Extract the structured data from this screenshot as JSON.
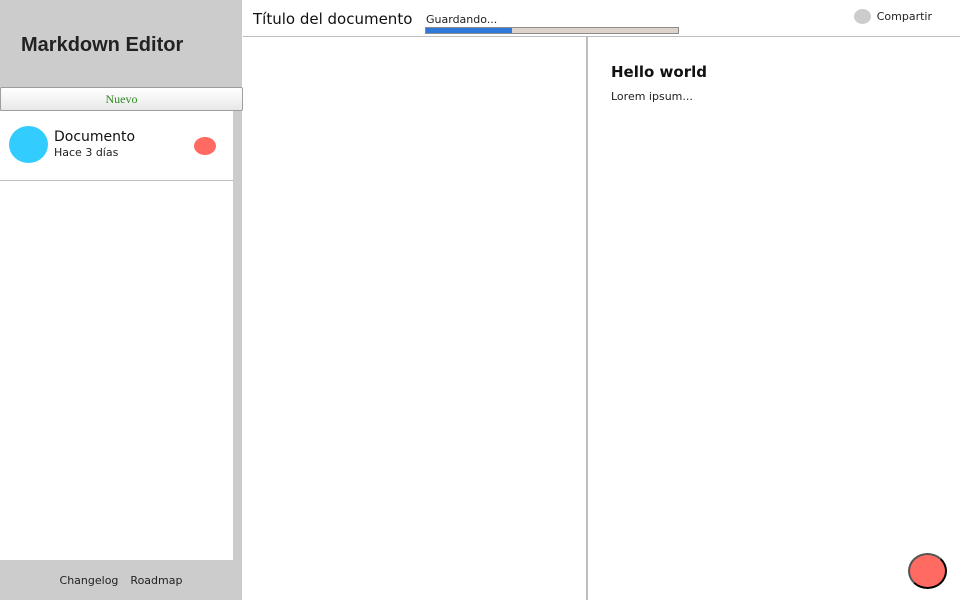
{
  "sidebar": {
    "app_title": "Markdown Editor",
    "new_button_label": "Nuevo",
    "documents": [
      {
        "name": "Documento",
        "date": "Hace 3 días"
      }
    ],
    "footer_links": [
      "Changelog",
      "Roadmap"
    ]
  },
  "topbar": {
    "document_title": "Título del documento",
    "saving_status": "Guardando...",
    "saving_progress": 0.34,
    "share_label": "Compartir"
  },
  "preview": {
    "heading": "Hello world",
    "body": "Lorem ipsum..."
  },
  "colors": {
    "avatar": "#33ccff",
    "delete": "#ff6b63",
    "fab": "#ff6b63",
    "progress": "#2f78d9",
    "new_button_text": "#2e8b22"
  }
}
